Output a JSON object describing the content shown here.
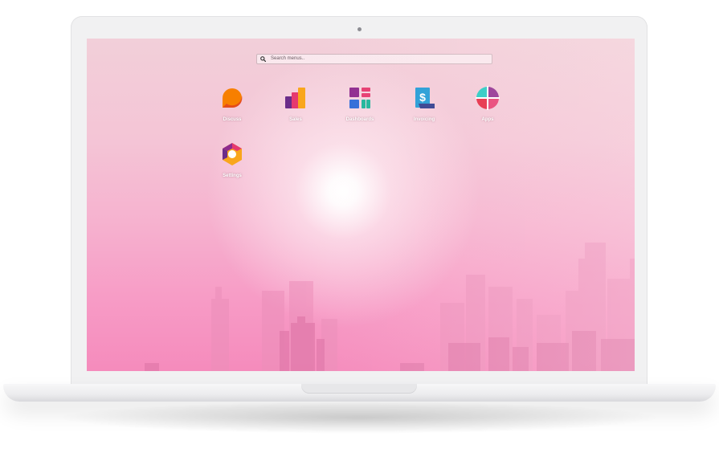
{
  "search": {
    "placeholder": "Search menus.."
  },
  "apps": [
    {
      "label": "Discuss",
      "icon": "discuss-icon"
    },
    {
      "label": "Sales",
      "icon": "sales-icon"
    },
    {
      "label": "Dashboards",
      "icon": "dashboards-icon"
    },
    {
      "label": "Invoicing",
      "icon": "invoicing-icon"
    },
    {
      "label": "Apps",
      "icon": "apps-icon"
    },
    {
      "label": "Settings",
      "icon": "settings-icon"
    }
  ],
  "colors": {
    "screen_top": "#f2cfd9",
    "screen_bottom": "#f58bbc",
    "skyline": "#e98bb5"
  }
}
